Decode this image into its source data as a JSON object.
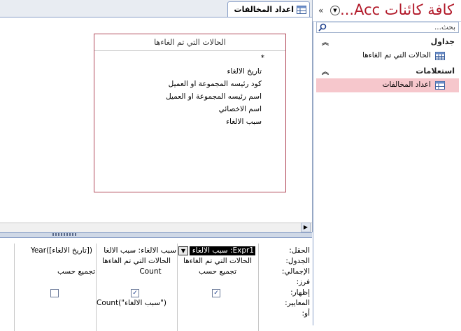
{
  "document_tab": {
    "label": "اعداد المخالفات"
  },
  "table_box": {
    "title": "الحالات التي تم الغاءها",
    "fields": [
      "*",
      "تاريخ الالغاء",
      "كود رئيسه المجموعة او العميل",
      "اسم  رئيسه المجموعة او العميل",
      "اسم الاخصائي",
      "سبب الالغاء"
    ]
  },
  "qbe": {
    "row_labels": [
      "الحقل:",
      "الجدول:",
      "الإجمالي:",
      "فرز:",
      "إظهار:",
      "المعايير:",
      "أو:"
    ],
    "columns": [
      {
        "field": "Expr1: سبب الالغاء",
        "table": "الحالات التي تم الغاءها",
        "total": "تجميع حسب",
        "show": true,
        "criteria": ""
      },
      {
        "field": "سبب الالغاء: سبب الالغا",
        "table": "الحالات التي تم الغاءها",
        "total": "Count",
        "show": true,
        "criteria": "Count(\"سبب الالغاء\")"
      },
      {
        "field": "Year([تاريخ الالغاء])",
        "table": "",
        "total": "تجميع حسب",
        "show": false,
        "criteria": ""
      }
    ]
  },
  "nav": {
    "title": "كافة كائنات Acc...",
    "search_placeholder": "بحث...",
    "groups": [
      {
        "label": "جداول",
        "items": [
          {
            "label": "الحالات التي تم الغاءها",
            "icon": "table-icon"
          }
        ]
      },
      {
        "label": "استعلامات",
        "items": [
          {
            "label": "اعداد المخالفات",
            "icon": "query-icon",
            "selected": true
          }
        ]
      }
    ]
  }
}
